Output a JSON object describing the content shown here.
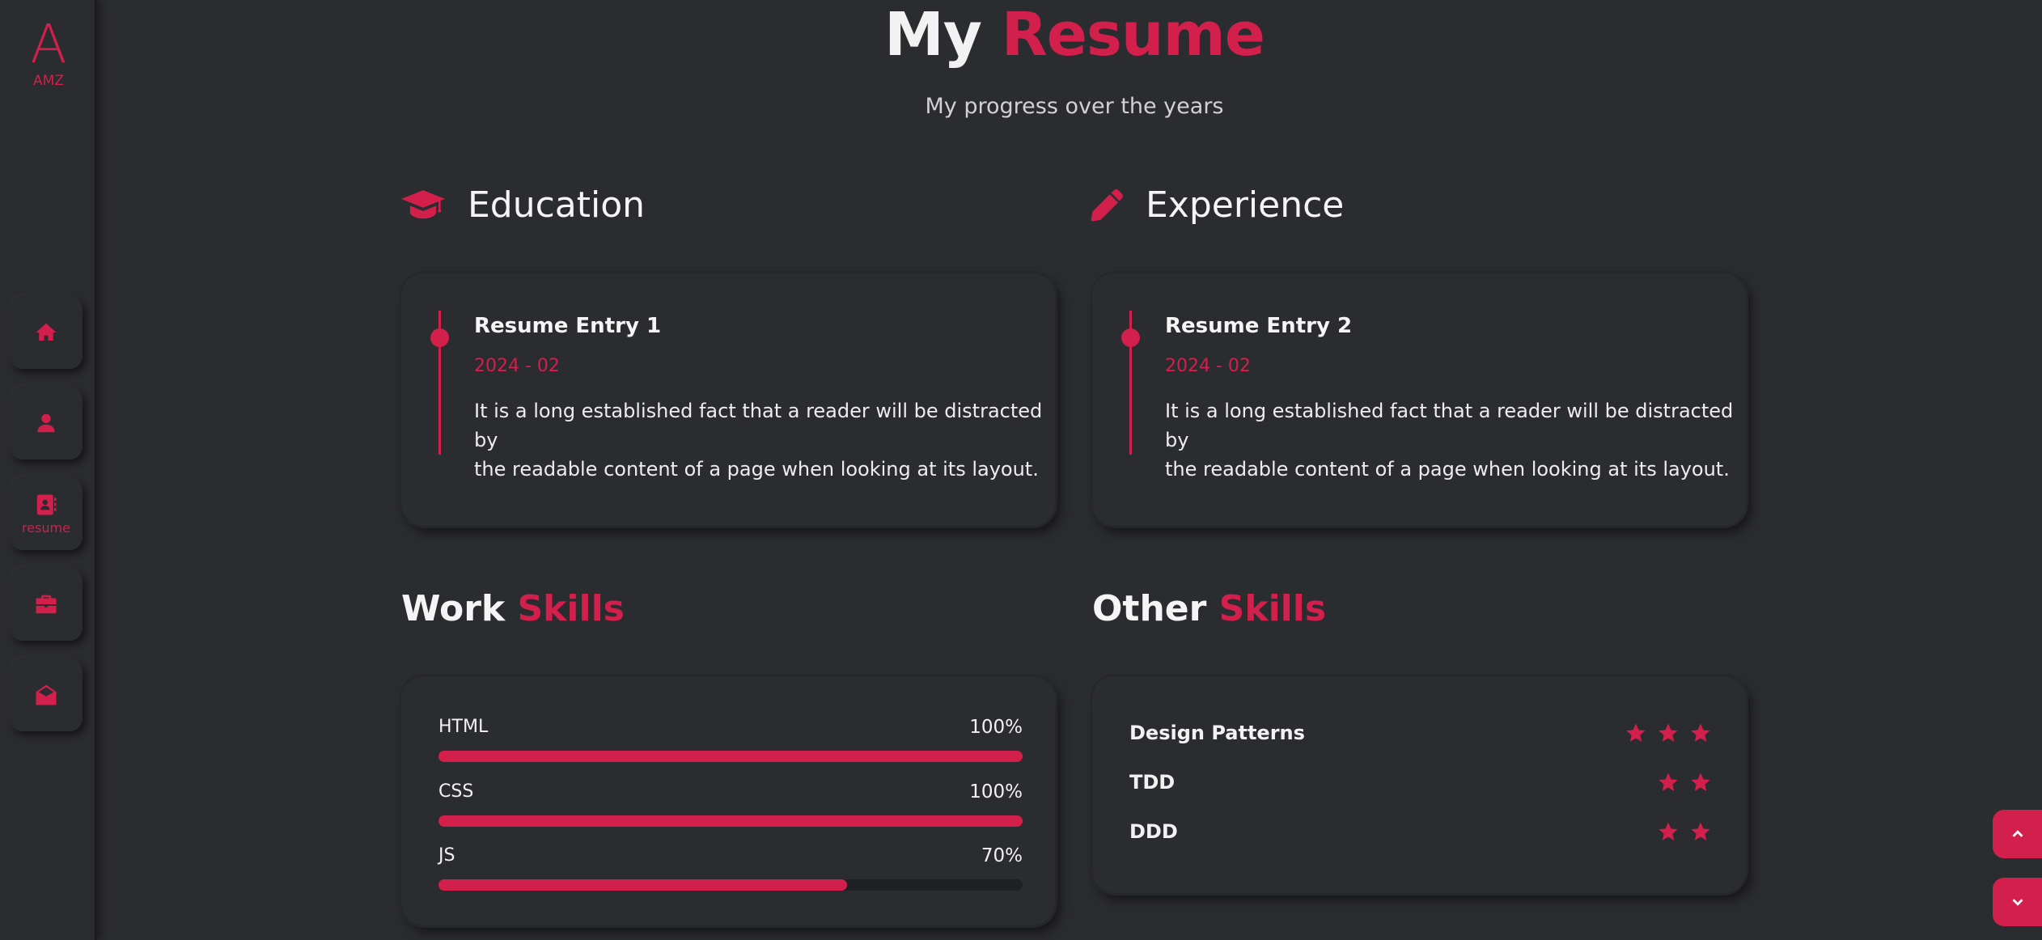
{
  "brand": {
    "logo_letter": "A",
    "logo_text": "AMZ"
  },
  "nav": [
    {
      "icon": "home-icon",
      "label": ""
    },
    {
      "icon": "user-icon",
      "label": ""
    },
    {
      "icon": "resume-icon",
      "label": "resume",
      "active": true
    },
    {
      "icon": "briefcase-icon",
      "label": ""
    },
    {
      "icon": "envelope-open-icon",
      "label": ""
    }
  ],
  "header": {
    "title_plain": "My",
    "title_accent": "Resume",
    "subtitle": "My progress over the years"
  },
  "education": {
    "heading": "Education",
    "icon": "graduation-cap-icon",
    "entry": {
      "title": "Resume Entry 1",
      "date": "2024 - 02",
      "line1": "It is a long established fact that a reader will be distracted by",
      "line2": "the readable content of a page when looking at its layout."
    }
  },
  "experience": {
    "heading": "Experience",
    "icon": "pencil-icon",
    "entry": {
      "title": "Resume Entry 2",
      "date": "2024 - 02",
      "line1": "It is a long established fact that a reader will be distracted by",
      "line2": "the readable content of a page when looking at its layout."
    }
  },
  "work_skills": {
    "heading_plain": "Work",
    "heading_accent": "Skills",
    "items": [
      {
        "name": "HTML",
        "value_label": "100%",
        "percent": 100
      },
      {
        "name": "CSS",
        "value_label": "100%",
        "percent": 100
      },
      {
        "name": "JS",
        "value_label": "70%",
        "percent": 70
      }
    ]
  },
  "other_skills": {
    "heading_plain": "Other",
    "heading_accent": "Skills",
    "items": [
      {
        "name": "Design Patterns",
        "stars": 3
      },
      {
        "name": "TDD",
        "stars": 2
      },
      {
        "name": "DDD",
        "stars": 2
      }
    ]
  },
  "colors": {
    "accent": "#d31f4b",
    "background": "#2b2c30"
  }
}
